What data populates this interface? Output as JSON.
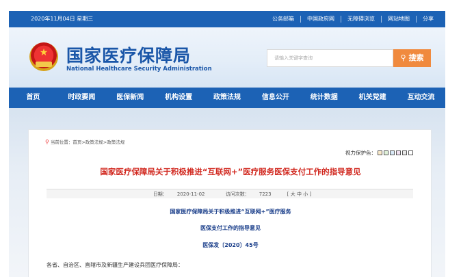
{
  "topbar": {
    "date": "2020年11月04日 星期三",
    "links": [
      "公务邮箱",
      "中国政府网",
      "无障碍浏览",
      "网站地图",
      "分享"
    ]
  },
  "header": {
    "logo_cn": "国家医疗保障局",
    "logo_en": "National Healthcare Security Administration",
    "search_placeholder": "请输入关键字查询",
    "search_button": "搜索"
  },
  "nav": [
    "首页",
    "时政要闻",
    "医保新闻",
    "机构设置",
    "政策法规",
    "信息公开",
    "统计数据",
    "机关党建",
    "互动交流"
  ],
  "breadcrumb": "当前位置：首页>政策法规>政策法规",
  "vision": {
    "label": "视力保护色：",
    "colors": [
      "#f8e8c8",
      "#dff0d8",
      "#d8e8f5",
      "#f0e0f0",
      "#e8e8e8",
      "#ffffff"
    ]
  },
  "article": {
    "title": "国家医疗保障局关于积极推进“互联网+”医疗服务医保支付工作的指导意见",
    "date_label": "日期：",
    "date": "2020-11-02",
    "visits_label": "访问次数：",
    "visits": "7223",
    "font_size": "[ 大 中 小 ]",
    "body_title_1": "国家医疗保障局关于积极推进“互联网+”医疗服务",
    "body_title_2": "医保支付工作的指导意见",
    "doc_no": "医保发〔2020〕45号",
    "body_start": "各省、自治区、直辖市及新疆生产建设兵团医疗保障局："
  }
}
